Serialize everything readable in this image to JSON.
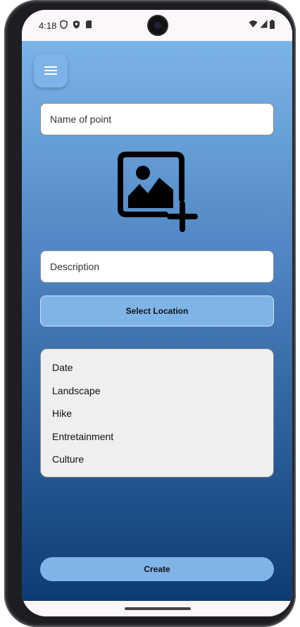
{
  "status_bar": {
    "time": "4:18"
  },
  "form": {
    "name_placeholder": "Name of point",
    "description_placeholder": "Description",
    "select_location_label": "Select Location",
    "tags": [
      "Date",
      "Landscape",
      "Hike",
      "Entretainment",
      "Culture"
    ],
    "create_label": "Create"
  },
  "icons": {
    "menu": "menu-icon",
    "image_add": "add-photo-icon"
  },
  "colors": {
    "gradient_top": "#7bb4e8",
    "gradient_bottom": "#0e3b72",
    "button": "#80b4e8"
  }
}
